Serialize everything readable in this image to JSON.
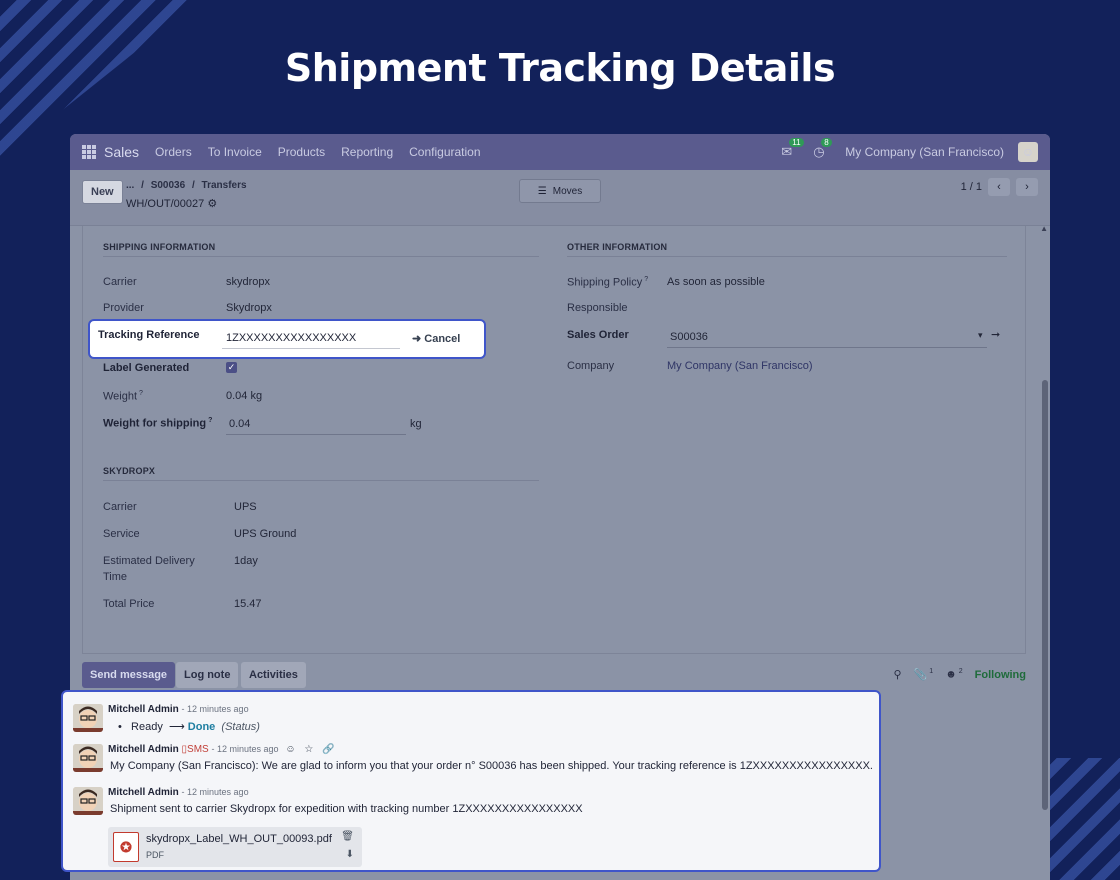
{
  "page_title": "Shipment Tracking Details",
  "navbar": {
    "brand": "Sales",
    "items": [
      "Orders",
      "To Invoice",
      "Products",
      "Reporting",
      "Configuration"
    ],
    "messages_count": "11",
    "activities_count": "8",
    "company": "My Company (San Francisco)"
  },
  "control_panel": {
    "new_label": "New",
    "breadcrumb_dots": "...",
    "breadcrumb_order": "S00036",
    "breadcrumb_transfers": "Transfers",
    "record": "WH/OUT/00027",
    "moves_label": "Moves",
    "pager": "1 / 1"
  },
  "shipping": {
    "title": "SHIPPING INFORMATION",
    "carrier_label": "Carrier",
    "carrier": "skydropx",
    "provider_label": "Provider",
    "provider": "Skydropx",
    "tracking_label": "Tracking Reference",
    "tracking": "1ZXXXXXXXXXXXXXXXX",
    "cancel_label": "Cancel",
    "label_generated_label": "Label Generated",
    "weight_label": "Weight",
    "weight": "0.04 kg",
    "weight_shipping_label": "Weight for shipping",
    "weight_shipping": "0.04",
    "weight_unit": "kg",
    "help_mark": "?"
  },
  "other": {
    "title": "OTHER INFORMATION",
    "policy_label": "Shipping Policy",
    "policy": "As soon as possible",
    "responsible_label": "Responsible",
    "sales_order_label": "Sales Order",
    "sales_order": "S00036",
    "company_label": "Company",
    "company": "My Company (San Francisco)"
  },
  "skydropx": {
    "title": "SKYDROPX",
    "carrier_label": "Carrier",
    "carrier": "UPS",
    "service_label": "Service",
    "service": "UPS Ground",
    "eta_label_1": "Estimated Delivery",
    "eta_label_2": "Time",
    "eta": "1day",
    "price_label": "Total Price",
    "price": "15.47"
  },
  "chatter": {
    "send_message": "Send message",
    "log_note": "Log note",
    "activities": "Activities",
    "attachments_count": "1",
    "followers_count": "2",
    "following": "Following"
  },
  "messages": [
    {
      "author": "Mitchell Admin",
      "time": "- 12 minutes ago",
      "bullet": "•",
      "from_status": "Ready",
      "arrow": "⟶",
      "to_status": "Done",
      "field": "(Status)"
    },
    {
      "author": "Mitchell Admin",
      "sms": "SMS",
      "time": "- 12 minutes ago",
      "body": "My Company (San Francisco): We are glad to inform you that your order n° S00036 has been shipped. Your tracking reference is 1ZXXXXXXXXXXXXXXXX."
    },
    {
      "author": "Mitchell Admin",
      "time": "- 12 minutes ago",
      "body": "Shipment sent to carrier Skydropx for expedition with tracking number 1ZXXXXXXXXXXXXXXXX"
    }
  ],
  "attachment": {
    "name": "skydropx_Label_WH_OUT_00093.pdf",
    "type": "PDF"
  }
}
